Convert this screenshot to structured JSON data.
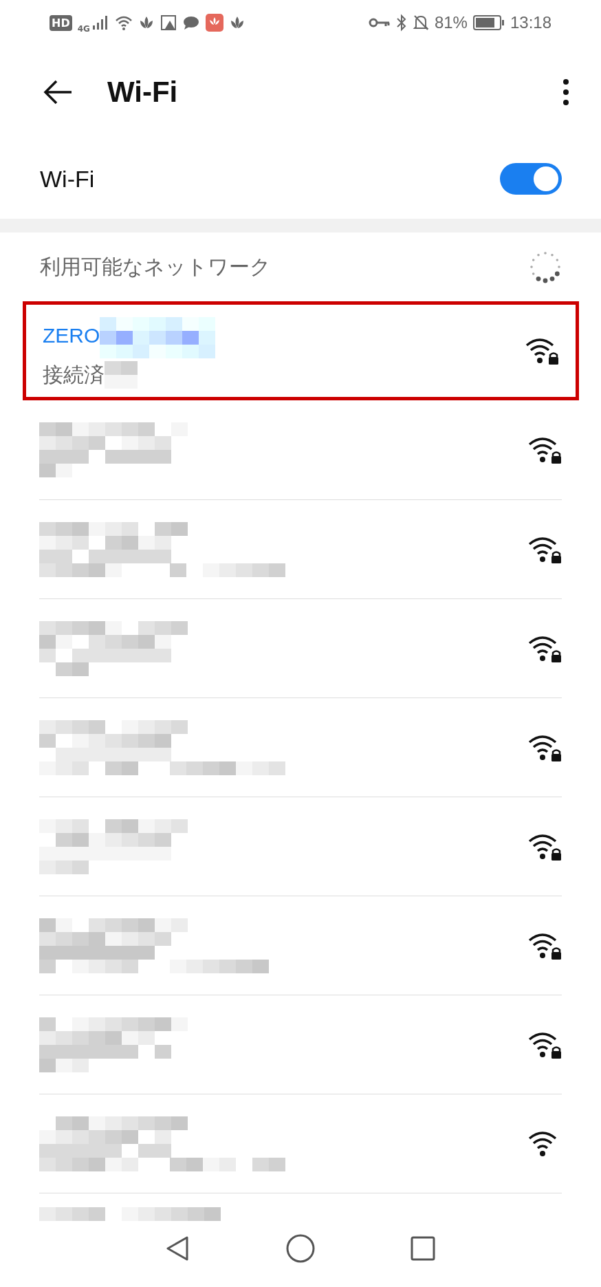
{
  "status_bar": {
    "hd": "HD",
    "network_type": "4G",
    "battery_percent": "81%",
    "time": "13:18"
  },
  "header": {
    "title": "Wi-Fi"
  },
  "wifi_toggle": {
    "label": "Wi-Fi",
    "on": true
  },
  "networks_section": {
    "title": "利用可能なネットワーク",
    "scanning": true
  },
  "networks": [
    {
      "name": "ZERO",
      "status": "接続済",
      "connected": true,
      "secured": true,
      "highlighted": true
    },
    {
      "connected": false,
      "secured": true,
      "highlighted": false
    },
    {
      "connected": false,
      "secured": true,
      "highlighted": false
    },
    {
      "connected": false,
      "secured": true,
      "highlighted": false
    },
    {
      "connected": false,
      "secured": true,
      "highlighted": false
    },
    {
      "connected": false,
      "secured": true,
      "highlighted": false
    },
    {
      "connected": false,
      "secured": true,
      "highlighted": false
    },
    {
      "connected": false,
      "secured": true,
      "highlighted": false
    },
    {
      "connected": false,
      "secured": false,
      "highlighted": false
    }
  ]
}
